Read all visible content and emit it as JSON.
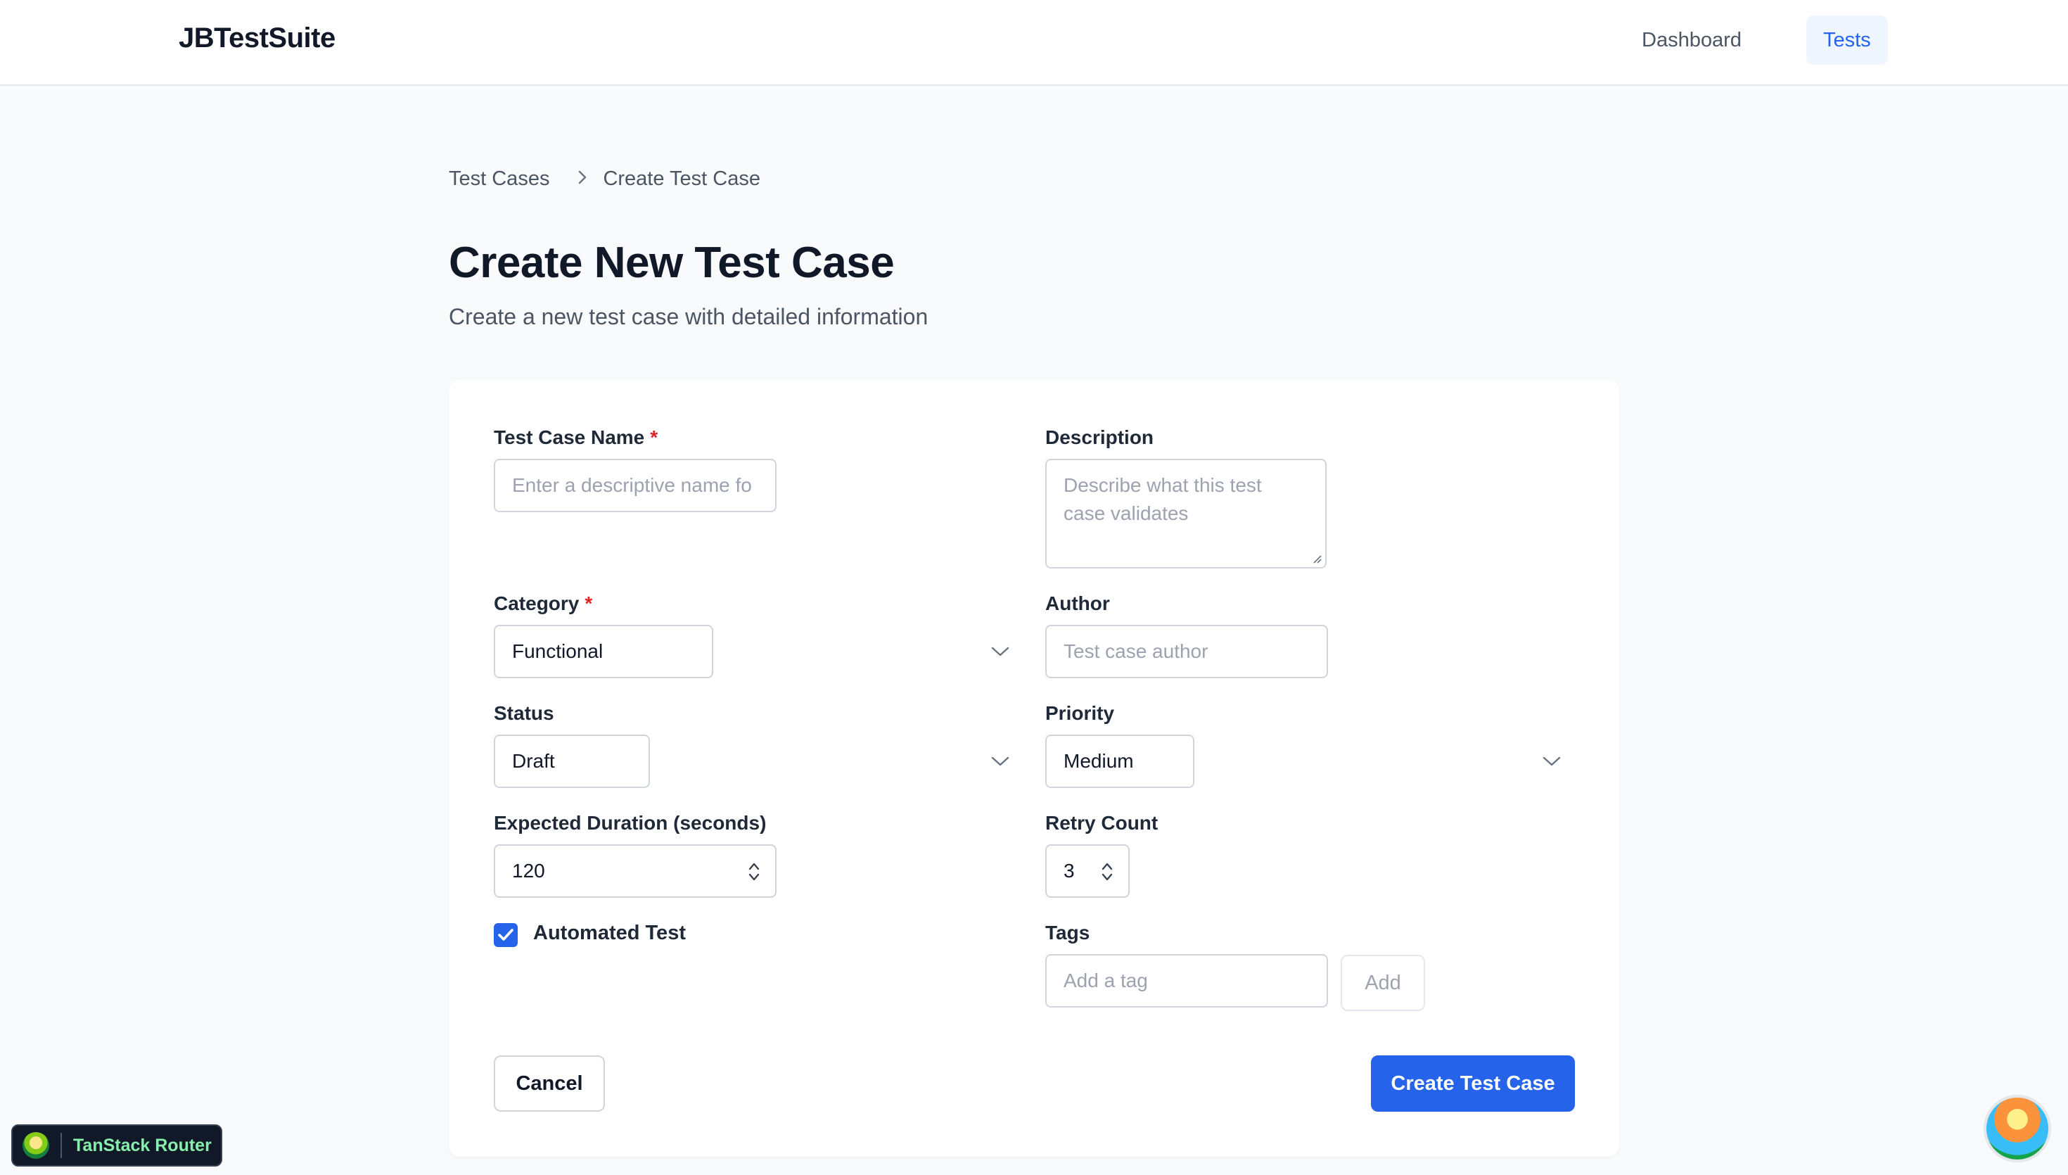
{
  "app": {
    "brand": "JBTestSuite"
  },
  "nav": {
    "dashboard": "Dashboard",
    "tests": "Tests"
  },
  "breadcrumb": {
    "parent": "Test Cases",
    "current": "Create Test Case"
  },
  "page": {
    "title": "Create New Test Case",
    "subtitle": "Create a new test case with detailed information"
  },
  "form": {
    "name": {
      "label": "Test Case Name",
      "required": "*",
      "placeholder": "Enter a descriptive name fo"
    },
    "description": {
      "label": "Description",
      "placeholder": "Describe what this test case validates"
    },
    "category": {
      "label": "Category",
      "required": "*",
      "value": "Functional"
    },
    "author": {
      "label": "Author",
      "placeholder": "Test case author"
    },
    "status": {
      "label": "Status",
      "value": "Draft"
    },
    "priority": {
      "label": "Priority",
      "value": "Medium"
    },
    "duration": {
      "label": "Expected Duration (seconds)",
      "value": "120"
    },
    "retry": {
      "label": "Retry Count",
      "value": "3"
    },
    "automated": {
      "label": "Automated Test",
      "checked": true
    },
    "tags": {
      "label": "Tags",
      "placeholder": "Add a tag",
      "add_label": "Add"
    },
    "cancel_label": "Cancel",
    "submit_label": "Create Test Case"
  },
  "devtools": {
    "label": "TanStack Router"
  },
  "colors": {
    "accent": "#2563eb",
    "required": "#dc2626"
  }
}
